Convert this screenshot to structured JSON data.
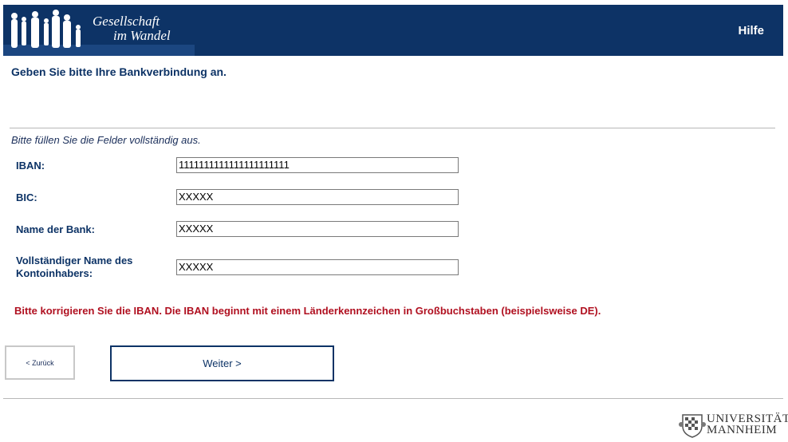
{
  "header": {
    "logo_line1": "Gesellschaft",
    "logo_line2": "im Wandel",
    "help_label": "Hilfe",
    "brand_color": "#0d3366"
  },
  "page": {
    "heading": "Geben Sie bitte Ihre Bankverbindung an.",
    "instruction": "Bitte füllen Sie die Felder vollständig aus."
  },
  "form": {
    "iban_label": "IBAN:",
    "iban_value": "1111111111111111111111",
    "bic_label": "BIC:",
    "bic_value": "XXXXX",
    "bank_label": "Name der Bank:",
    "bank_value": "XXXXX",
    "holder_label_line1": "Vollständiger Name des",
    "holder_label_line2": "Kontoinhabers:",
    "holder_value": "XXXXX"
  },
  "error": {
    "message": "Bitte korrigieren Sie die IBAN. Die IBAN beginnt mit einem Länderkennzeichen in Großbuchstaben (beispielsweise DE).",
    "color": "#b01020"
  },
  "nav": {
    "back_label": "< Zurück",
    "next_label": "Weiter >"
  },
  "footer": {
    "uni_line1": "UNIVERSITÄT",
    "uni_line2": "MANNHEIM"
  }
}
